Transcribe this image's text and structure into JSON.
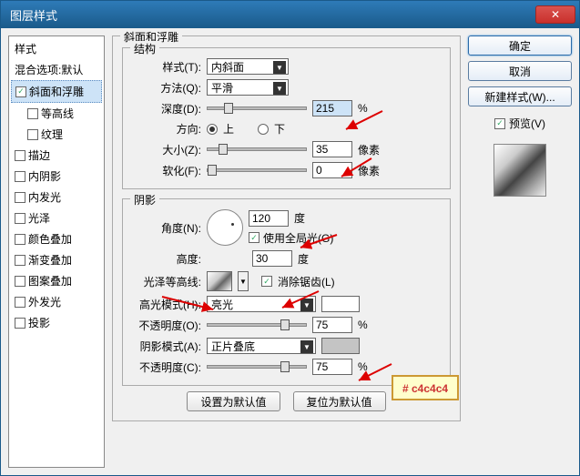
{
  "window": {
    "title": "图层样式"
  },
  "sidebar": {
    "items": [
      {
        "label": "样式",
        "kind": "header"
      },
      {
        "label": "混合选项:默认",
        "kind": "header"
      },
      {
        "label": "斜面和浮雕",
        "checked": true,
        "selected": true
      },
      {
        "label": "等高线",
        "checked": false,
        "indented": true
      },
      {
        "label": "纹理",
        "checked": false,
        "indented": true
      },
      {
        "label": "描边",
        "checked": false
      },
      {
        "label": "内阴影",
        "checked": false
      },
      {
        "label": "内发光",
        "checked": false
      },
      {
        "label": "光泽",
        "checked": false
      },
      {
        "label": "颜色叠加",
        "checked": false
      },
      {
        "label": "渐变叠加",
        "checked": false
      },
      {
        "label": "图案叠加",
        "checked": false
      },
      {
        "label": "外发光",
        "checked": false
      },
      {
        "label": "投影",
        "checked": false
      }
    ]
  },
  "panel": {
    "title": "斜面和浮雕",
    "structure": {
      "title": "结构",
      "style_label": "样式(T):",
      "style_value": "内斜面",
      "technique_label": "方法(Q):",
      "technique_value": "平滑",
      "depth_label": "深度(D):",
      "depth_value": "215",
      "depth_unit": "%",
      "direction_label": "方向:",
      "up": "上",
      "down": "下",
      "size_label": "大小(Z):",
      "size_value": "35",
      "size_unit": "像素",
      "soften_label": "软化(F):",
      "soften_value": "0",
      "soften_unit": "像素"
    },
    "shading": {
      "title": "阴影",
      "angle_label": "角度(N):",
      "angle_value": "120",
      "angle_unit": "度",
      "global_light_label": "使用全局光(G)",
      "global_light_checked": true,
      "altitude_label": "高度:",
      "altitude_value": "30",
      "altitude_unit": "度",
      "gloss_label": "光泽等高线:",
      "antialias_label": "消除锯齿(L)",
      "antialias_checked": true,
      "highlight_mode_label": "高光模式(H):",
      "highlight_mode_value": "亮光",
      "highlight_opacity_label": "不透明度(O):",
      "highlight_opacity_value": "75",
      "highlight_opacity_unit": "%",
      "shadow_mode_label": "阴影模式(A):",
      "shadow_mode_value": "正片叠底",
      "shadow_opacity_label": "不透明度(C):",
      "shadow_opacity_value": "75",
      "shadow_opacity_unit": "%"
    },
    "buttons": {
      "reset_default": "设置为默认值",
      "reset_to_default": "复位为默认值"
    }
  },
  "right": {
    "ok": "确定",
    "cancel": "取消",
    "new_style": "新建样式(W)...",
    "preview_label": "预览(V)",
    "preview_checked": true
  },
  "annotation": {
    "color_code": "# c4c4c4"
  }
}
